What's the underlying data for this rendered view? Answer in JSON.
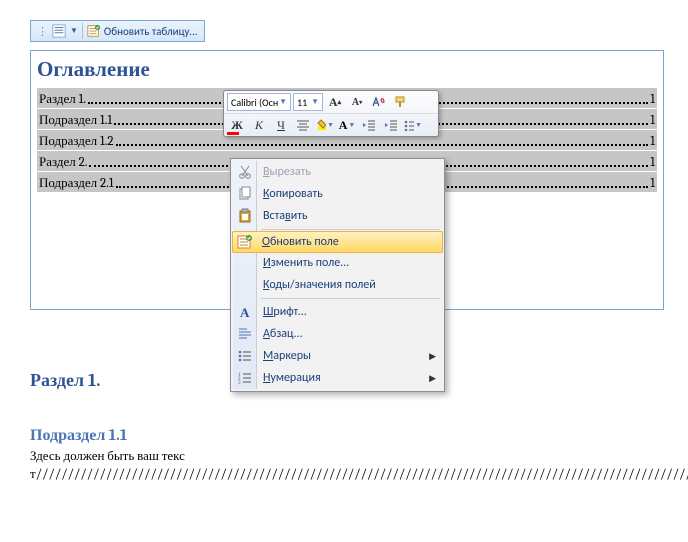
{
  "toc_tab": {
    "label": "Обновить таблицу..."
  },
  "document": {
    "title": "Оглавление",
    "toc_rows": [
      {
        "label": "Раздел 1.",
        "page": "1"
      },
      {
        "label": "Подраздел 1.1",
        "page": "1"
      },
      {
        "label": "Подраздел 1.2",
        "page": "1"
      },
      {
        "label": "Раздел 2.",
        "page": "1"
      },
      {
        "label": "Подраздел 2.1",
        "page": "1"
      }
    ]
  },
  "mini_toolbar": {
    "font_name": "Calibri (Осн",
    "font_size": "11"
  },
  "context_menu": {
    "items": [
      {
        "label": "Вырезать",
        "u": 0,
        "icon": "cut",
        "disabled": true
      },
      {
        "label": "Копировать",
        "u": 0,
        "icon": "copy"
      },
      {
        "label": "Вставить",
        "u": 4,
        "icon": "paste"
      },
      {
        "sep": true
      },
      {
        "label": "Обновить поле",
        "u": 0,
        "icon": "update",
        "highlight": true
      },
      {
        "label": "Изменить поле...",
        "u": 0
      },
      {
        "label": "Коды/значения полей",
        "u": 0
      },
      {
        "sep": true
      },
      {
        "label": "Шрифт...",
        "u": 0,
        "icon": "font"
      },
      {
        "label": "Абзац...",
        "u": 0,
        "icon": "paragraph"
      },
      {
        "label": "Маркеры",
        "u": 0,
        "icon": "bullets",
        "submenu": true
      },
      {
        "label": "Нумерация",
        "u": 0,
        "icon": "numbering",
        "submenu": true
      }
    ]
  },
  "body": {
    "h1": "Раздел 1.",
    "h2": "Подраздел 1.1",
    "text": "Здесь должен быть ваш текст///////////////////////////////////////////////////////////////////////////////////////////////////////////////////////////////////////////////////////////////////////////////////////////////////////////////////////////////////////////////////////////////////////"
  },
  "icons": {
    "toc": "toc-icon",
    "update": "update-icon"
  }
}
